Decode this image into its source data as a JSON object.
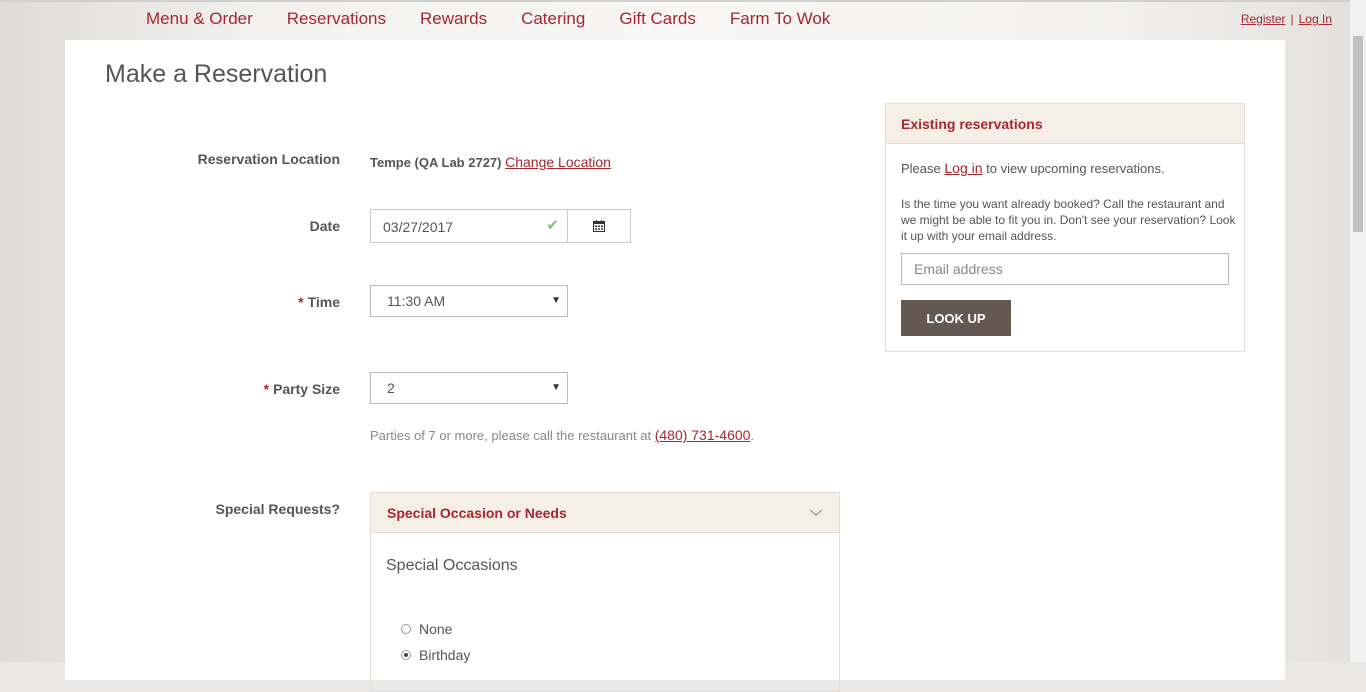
{
  "nav": {
    "items": [
      "Menu & Order",
      "Reservations",
      "Rewards",
      "Catering",
      "Gift Cards",
      "Farm To Wok"
    ],
    "register": "Register",
    "separator": "|",
    "login": "Log In"
  },
  "page": {
    "title": "Make a Reservation"
  },
  "form": {
    "location_label": "Reservation Location",
    "location_value": "Tempe (QA Lab 2727)",
    "change_location": "Change Location",
    "date_label": "Date",
    "date_value": "03/27/2017",
    "required_mark": "*",
    "time_label": "Time",
    "time_value": "11:30 AM",
    "party_label": "Party Size",
    "party_value": "2",
    "party_note": "Parties of 7 or more, please call the restaurant at ",
    "phone": "(480) 731-4600",
    "party_note_end": ".",
    "special_label": "Special Requests?",
    "special_header": "Special Occasion or Needs",
    "occasions_title": "Special Occasions",
    "occasions": [
      {
        "label": "None",
        "selected": false
      },
      {
        "label": "Birthday",
        "selected": true
      }
    ]
  },
  "sidebar": {
    "title": "Existing reservations",
    "please": "Please ",
    "login_link": "Log in",
    "view_text": " to view upcoming reservations.",
    "para": "Is the time you want already booked? Call the restaurant and we might be able to fit you in.  Don't see your reservation? Look it up with your email address.",
    "email_placeholder": "Email address",
    "lookup_label": "LOOK UP"
  },
  "colors": {
    "accent": "#a8262e",
    "button": "#635950",
    "header_bg": "#f6efe8"
  }
}
